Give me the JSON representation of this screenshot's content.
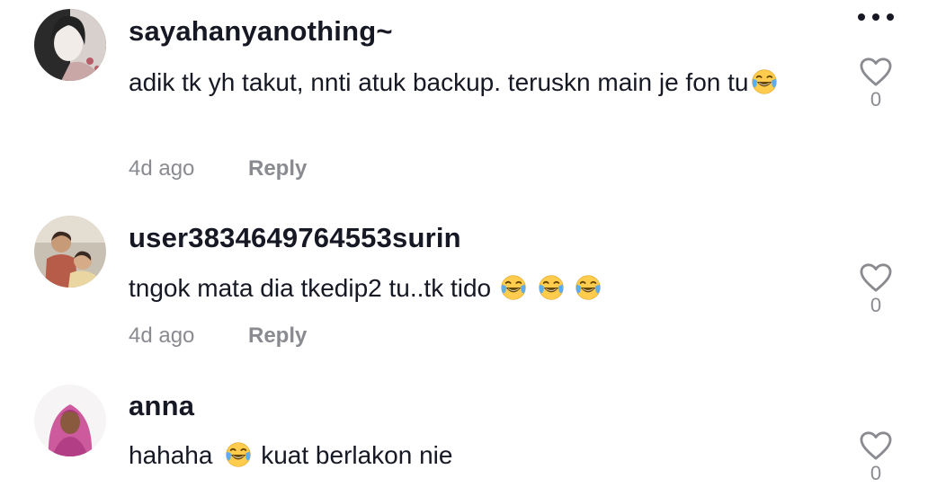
{
  "more_menu_icon": "ellipsis-horizontal-icon",
  "like_icon": "heart-outline-icon",
  "reply_label": "Reply",
  "comments": [
    {
      "username": "sayahanyanothing~",
      "text_before_emoji": "adik tk yh takut, nnti atuk backup. teruskn main je fon tu",
      "text_after_emoji": "",
      "emoji": "face-with-tears-of-joy",
      "emoji_count": 1,
      "time": "4d ago",
      "likes": "0"
    },
    {
      "username": "user3834649764553surin",
      "text_before_emoji": "tngok mata dia tkedip2 tu..tk tido",
      "text_after_emoji": "",
      "emoji": "face-with-tears-of-joy",
      "emoji_count": 3,
      "time": "4d ago",
      "likes": "0"
    },
    {
      "username": "anna",
      "text_before_emoji": "hahaha",
      "text_after_emoji": "kuat berlakon nie",
      "emoji": "face-with-tears-of-joy",
      "emoji_count": 1,
      "time": "",
      "likes": "0"
    }
  ],
  "colors": {
    "text_primary": "#161823",
    "text_secondary": "#8a8b91",
    "background": "#ffffff"
  }
}
